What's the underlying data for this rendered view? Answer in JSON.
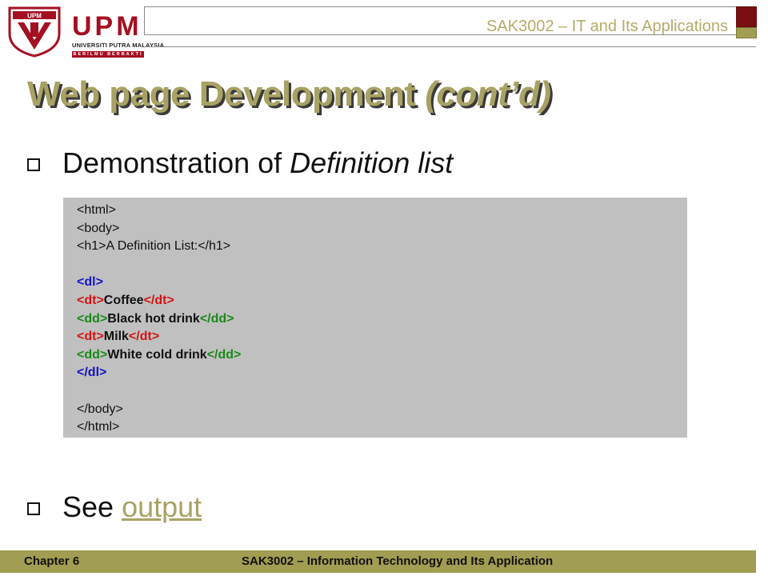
{
  "header": {
    "logo": {
      "shield_text": "UPM",
      "wordmark": "UPM",
      "university": "UNIVERSITI PUTRA MALAYSIA",
      "motto": "BERILMU BERBAKTI"
    },
    "course_title": "SAK3002 – IT and Its Applications",
    "colors": {
      "accent": "#a8a264",
      "brand_red": "#a50f22",
      "dark_red": "#7a0f12",
      "olive": "#a19d52"
    }
  },
  "slide": {
    "title_main": "Web page Development",
    "title_suffix": "(cont’d)",
    "bullet1": {
      "text": "Demonstration of ",
      "emphasis": "Definition list"
    },
    "code_lines": [
      {
        "segments": [
          {
            "t": "<html>",
            "c": "plain"
          }
        ]
      },
      {
        "segments": [
          {
            "t": "<body>",
            "c": "plain"
          }
        ]
      },
      {
        "segments": [
          {
            "t": "<h1>A Definition List:</h1>",
            "c": "plain"
          }
        ]
      },
      {
        "segments": []
      },
      {
        "segments": [
          {
            "t": "<dl>",
            "c": "blue"
          }
        ]
      },
      {
        "segments": [
          {
            "t": "<dt>",
            "c": "red"
          },
          {
            "t": "Coffee",
            "c": "bold"
          },
          {
            "t": "</dt>",
            "c": "red"
          }
        ]
      },
      {
        "segments": [
          {
            "t": "<dd>",
            "c": "green"
          },
          {
            "t": "Black hot drink",
            "c": "bold"
          },
          {
            "t": "</dd>",
            "c": "green"
          }
        ]
      },
      {
        "segments": [
          {
            "t": "<dt>",
            "c": "red"
          },
          {
            "t": "Milk",
            "c": "bold"
          },
          {
            "t": "</dt>",
            "c": "red"
          }
        ]
      },
      {
        "segments": [
          {
            "t": "<dd>",
            "c": "green"
          },
          {
            "t": "White cold drink",
            "c": "bold"
          },
          {
            "t": "</dd>",
            "c": "green"
          }
        ]
      },
      {
        "segments": [
          {
            "t": "</dl>",
            "c": "blue"
          }
        ]
      },
      {
        "segments": []
      },
      {
        "segments": [
          {
            "t": "</body>",
            "c": "plain"
          }
        ]
      },
      {
        "segments": [
          {
            "t": "</html>",
            "c": "plain"
          }
        ]
      }
    ],
    "bullet2": {
      "text": "See ",
      "link": "output"
    }
  },
  "footer": {
    "chapter": "Chapter 6",
    "course": "SAK3002 – Information Technology and Its Application"
  }
}
